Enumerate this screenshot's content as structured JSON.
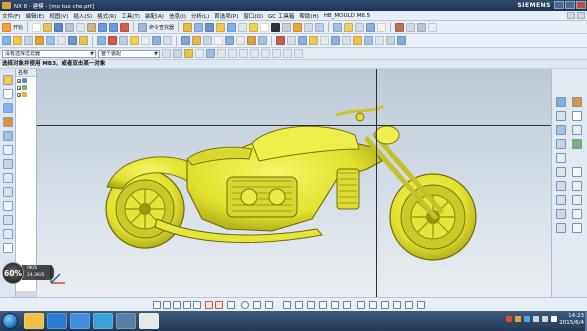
{
  "window": {
    "title": "NX 8 - 建模 - [mo tuo che.prt]",
    "brand": "SIEMENS"
  },
  "menu": {
    "items": [
      "文件(F)",
      "编辑(E)",
      "视图(V)",
      "插入(S)",
      "格式(R)",
      "工具(T)",
      "装配(A)",
      "信息(I)",
      "分析(L)",
      "首选项(P)",
      "窗口(O)",
      "GC 工具箱",
      "帮助(H)",
      "HB_MOULD M6.5"
    ]
  },
  "toolbar": {
    "start_label": "开始",
    "command_finder_label": "命令查找器"
  },
  "filter": {
    "type_filter": "没有选择过滤器",
    "scope": "整个装配"
  },
  "prompt": {
    "text": "选择对象并使用 MB3，或者双击某一对象"
  },
  "navigator": {
    "header": "名称"
  },
  "performance_widget": {
    "percent": "60%",
    "line1": "0K/S",
    "line2": "24.3K/S"
  },
  "taskbar": {
    "time": "14:23",
    "date": "2015/6/4"
  },
  "colors": {
    "model": "#e3e12e",
    "viewport_top": "#bcc9d6",
    "viewport_bottom": "#e9edf1",
    "titlebar": "#2f4a6c"
  }
}
